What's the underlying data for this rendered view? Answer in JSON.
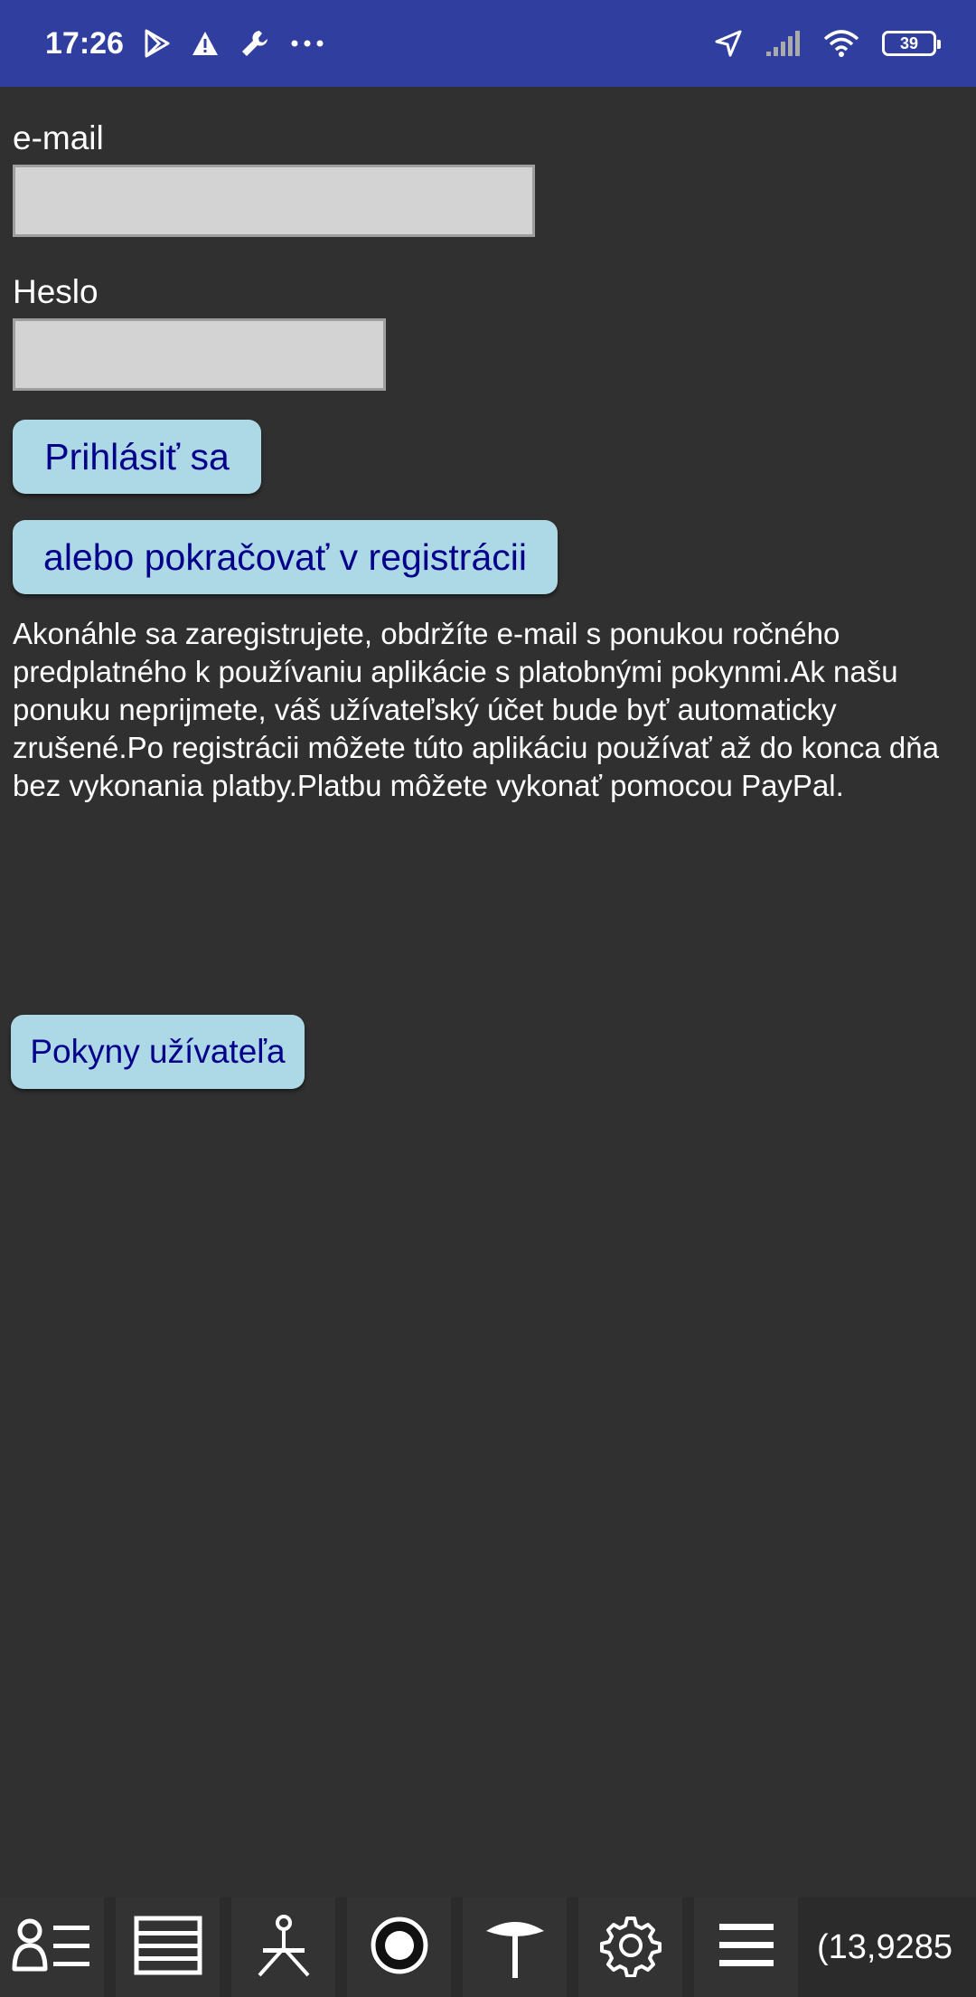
{
  "status_bar": {
    "time": "17:26",
    "left_icons": [
      "play-store-icon",
      "warning-icon",
      "wrench-icon",
      "more-dots-icon"
    ],
    "right_icons": [
      "location-arrow-icon",
      "signal-icon",
      "wifi-icon",
      "battery-icon"
    ],
    "battery_level": "39"
  },
  "form": {
    "email_label": "e-mail",
    "email_value": "",
    "password_label": "Heslo",
    "password_value": "",
    "login_button": "Prihlásiť sa",
    "register_button": "alebo pokračovať v registrácii",
    "info_text": "Akonáhle sa zaregistrujete, obdržíte e-mail s ponukou ročného predplatného k používaniu aplikácie s platobnými pokynmi.Ak našu ponuku neprijmete, váš užívateľský účet bude byť automaticky zrušené.Po registrácii môžete túto aplikáciu používať až do konca dňa bez vykonania platby.Platbu môžete vykonať pomocou PayPal.",
    "guide_button": "Pokyny užívateľa"
  },
  "bottom_toolbar": {
    "items": [
      "user-list-icon",
      "layers-icon",
      "survey-tripod-icon",
      "record-circle-icon",
      "antenna-icon",
      "gear-icon",
      "menu-icon"
    ],
    "coordinate_readout": "(13,9285"
  },
  "colors": {
    "status_bar": "#303f9f",
    "background": "#303030",
    "button_bg": "#add8e6",
    "button_text": "#00008b",
    "field_bg": "#d3d3d3"
  }
}
